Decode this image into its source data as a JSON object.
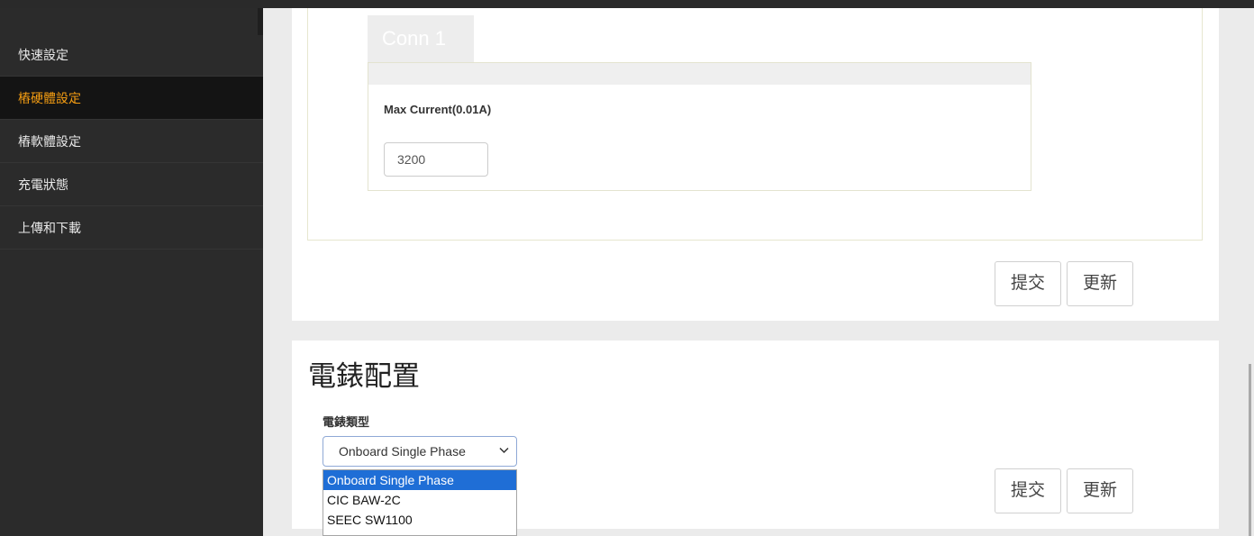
{
  "sidebar": {
    "items": [
      {
        "label": "快速設定",
        "active": false
      },
      {
        "label": "樁硬體設定",
        "active": true
      },
      {
        "label": "樁軟體設定",
        "active": false
      },
      {
        "label": "充電狀態",
        "active": false
      },
      {
        "label": "上傳和下載",
        "active": false
      }
    ]
  },
  "connector": {
    "tab_label": "Conn 1",
    "max_current_label": "Max Current(0.01A)",
    "max_current_value": "3200"
  },
  "panel1": {
    "submit_label": "提交",
    "refresh_label": "更新"
  },
  "meter": {
    "title": "電錶配置",
    "type_label": "電錶類型",
    "selected": "Onboard Single Phase",
    "options": [
      "Onboard Single Phase",
      "CIC BAW-2C",
      "SEEC SW1100"
    ],
    "submit_label": "提交",
    "refresh_label": "更新"
  },
  "colors": {
    "active_nav": "#f39c12",
    "sidebar_bg": "#2b2b2b",
    "dropdown_highlight": "#1f6ed6"
  },
  "icons": {
    "select_arrow": "chevron-down-icon"
  }
}
